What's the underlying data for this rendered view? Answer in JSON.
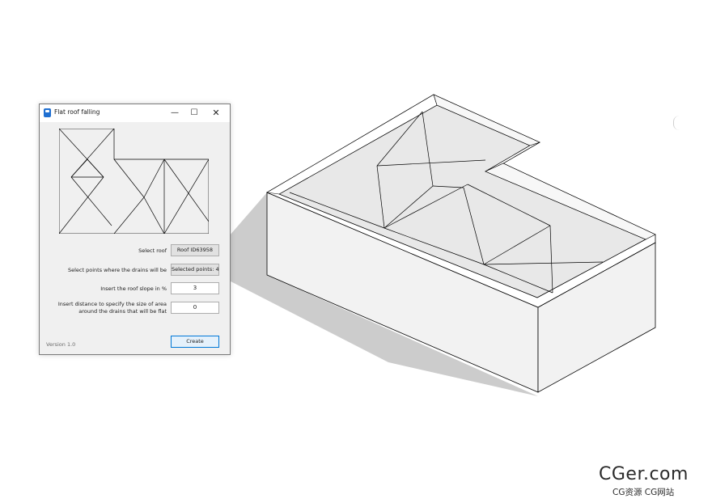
{
  "window": {
    "title": "Flat roof falling",
    "minimize_glyph": "—",
    "maximize_glyph": "☐",
    "close_glyph": "✕",
    "app_icon": "app-icon"
  },
  "form": {
    "select_roof_label": "Select roof",
    "select_roof_value": "Roof ID63958",
    "select_points_label": "Select points where the drains will be",
    "select_points_value": "Selected points: 4",
    "slope_label": "Insert the roof slope in %",
    "slope_value": "3",
    "distance_label_line1": "Insert distance to specify the size of area",
    "distance_label_line2": "around the drains that will be flat",
    "distance_value": "0",
    "create_label": "Create",
    "version": "Version 1.0"
  },
  "watermark": {
    "main": "CGer.com",
    "sub": "CG资源 CG网站"
  },
  "colors": {
    "accent": "#0078d7",
    "dialog_bg": "#f0f0f0",
    "shadow": "#cccccc",
    "wall_front": "#f2f2f2",
    "roof": "#e8e8e8"
  }
}
